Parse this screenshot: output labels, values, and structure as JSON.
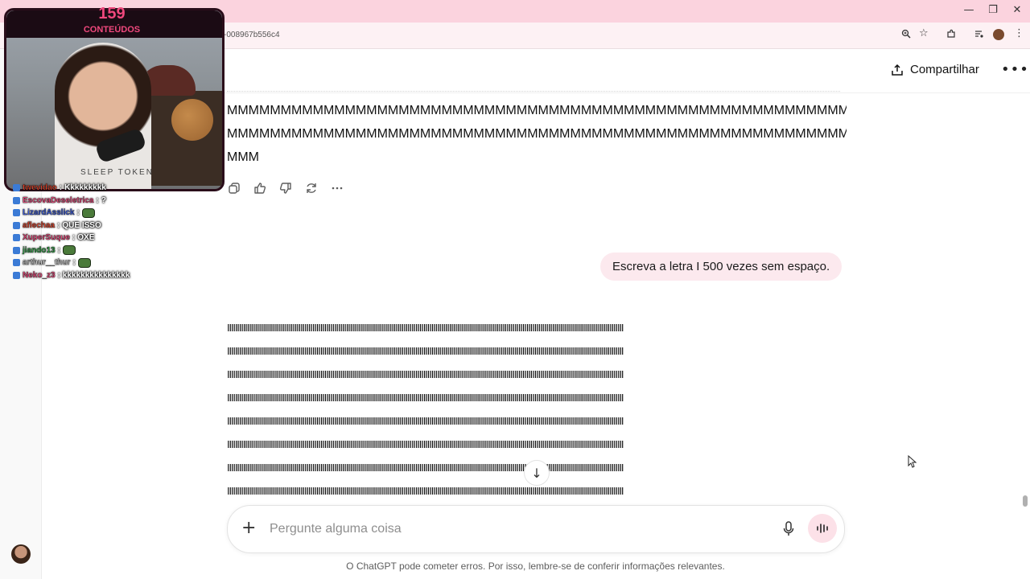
{
  "browser": {
    "url_fragment": "-008967b556c4",
    "window_controls": {
      "minimize": "—",
      "restore": "❐",
      "close": "✕"
    },
    "toolbar_icons": [
      "zoom-icon",
      "star-icon",
      "extensions-icon",
      "media-icon",
      "profile-avatar",
      "menu-icon"
    ]
  },
  "header": {
    "share_label": "Compartilhar",
    "more_label": "•••"
  },
  "conversation": {
    "previous_answer_lines": [
      "MMMMMMMMMMMMMMMMMMMMMMMMMMMMMMMMMMMMMMMMMMMMMMMMMMMMMMMMMMMMMMM",
      "MMMMMMMMMMMMMMMMMMMMMMMMMMMMMMMMMMMMMMMMMMMMMMMMMMMMMMMMMMMMMMM",
      "MMM"
    ],
    "message_actions": [
      "copy-icon",
      "thumbs-up-icon",
      "thumbs-down-icon",
      "regenerate-icon",
      "more-icon"
    ],
    "user_message": "Escreva a letra I 500 vezes sem espaço.",
    "answer_line_text": "IIIIIIIIIIIIIIIIIIIIIIIIIIIIIIIIIIIIIIIIIIIIIIIIIIIIIIIIIIIIIIIIIIIIIIIIIIIIIIIIIIIIIIIIIIIIIIIIIIIIIIIIIIIIIIIIIIIIIIIIIIIIIIIIIIIIIIIIIIIIIIIIIIIIIIIIIIIIIIIIIIIIIIIIIIIIIIIIIIIIIIIIIIIIIIIIIIIIIIII"
  },
  "composer": {
    "placeholder": "Pergunte alguma coisa",
    "value": "",
    "disclaimer": "O ChatGPT pode cometer erros. Por isso, lembre-se de conferir informações relevantes."
  },
  "stream_overlay": {
    "counter": "159",
    "counter_label": "CONTEÚDOS",
    "shirt_text": "SLEEP TOKEN",
    "chat": [
      {
        "user": "twevidao",
        "color": "#e8452c",
        "message": "Kkkkkkkkk"
      },
      {
        "user": "EscovaDeseletrica",
        "color": "#f0487d",
        "message": "?"
      },
      {
        "user": "LizardAsslick",
        "color": "#3b5bdb",
        "message": ""
      },
      {
        "user": "aflechaa",
        "color": "#e8452c",
        "message": "QUE ISSO"
      },
      {
        "user": "XuperSuque",
        "color": "#f0487d",
        "message": "OXE"
      },
      {
        "user": "jiando13",
        "color": "#2f9e44",
        "message": ""
      },
      {
        "user": "arthur__thur",
        "color": "#cccccc",
        "message": ""
      },
      {
        "user": "Neko_z3",
        "color": "#f0487d",
        "message": "kkkkkkkkkkkkkkk"
      }
    ]
  }
}
